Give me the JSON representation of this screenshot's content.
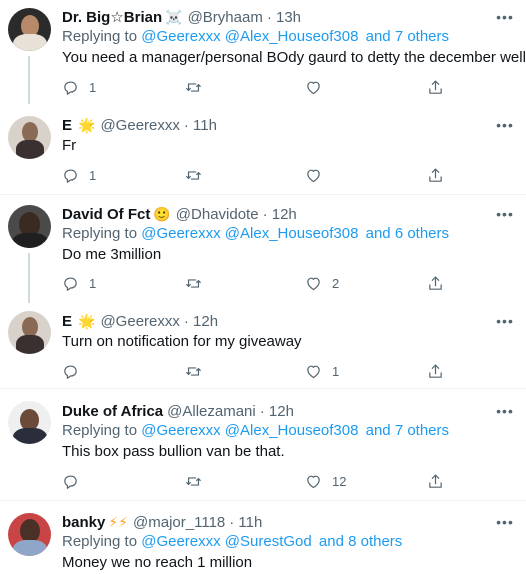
{
  "icons": {
    "reply": "reply-icon",
    "retweet": "retweet-icon",
    "like": "like-icon",
    "share": "share-icon",
    "more": "more-icon"
  },
  "tweets": [
    {
      "name": "Dr. Big☆Brian",
      "emoji": "☠️",
      "handle": "@Bryhaam",
      "time": "· 13h",
      "replying_prefix": "Replying to",
      "replying_users": "@Geerexxx @Alex_Houseof308",
      "replying_others": "and 7 others",
      "text": "You need a manager/personal BOdy gaurd to detty the december well",
      "text_emoji": "😤",
      "reply_count": "1",
      "retweet_count": "",
      "like_count": ""
    },
    {
      "name": "E",
      "emoji": "🌟",
      "handle": "@Geerexxx",
      "time": "· 11h",
      "text": "Fr",
      "reply_count": "1",
      "retweet_count": "",
      "like_count": ""
    },
    {
      "name": "David Of Fct",
      "emoji": "🙂",
      "handle": "@Dhavidote",
      "time": "· 12h",
      "replying_prefix": "Replying to",
      "replying_users": "@Geerexxx @Alex_Houseof308",
      "replying_others": "and 6 others",
      "text": "Do me 3million",
      "reply_count": "1",
      "retweet_count": "",
      "like_count": "2"
    },
    {
      "name": "E",
      "emoji": "🌟",
      "handle": "@Geerexxx",
      "time": "· 12h",
      "text": "Turn on notification for my giveaway",
      "reply_count": "",
      "retweet_count": "",
      "like_count": "1"
    },
    {
      "name": "Duke of Africa",
      "emoji": "",
      "handle": "@Allezamani",
      "time": "· 12h",
      "replying_prefix": "Replying to",
      "replying_users": "@Geerexxx @Alex_Houseof308",
      "replying_others": "and 7 others",
      "text": "This box pass bullion van be that.",
      "reply_count": "",
      "retweet_count": "",
      "like_count": "12"
    },
    {
      "name": "banky",
      "emoji": "⚡⚡",
      "handle": "@major_1118",
      "time": "· 11h",
      "replying_prefix": "Replying to",
      "replying_users": "@Geerexxx @SurestGod",
      "replying_others": "and 8 others",
      "text": "Money we no reach 1 million"
    }
  ]
}
